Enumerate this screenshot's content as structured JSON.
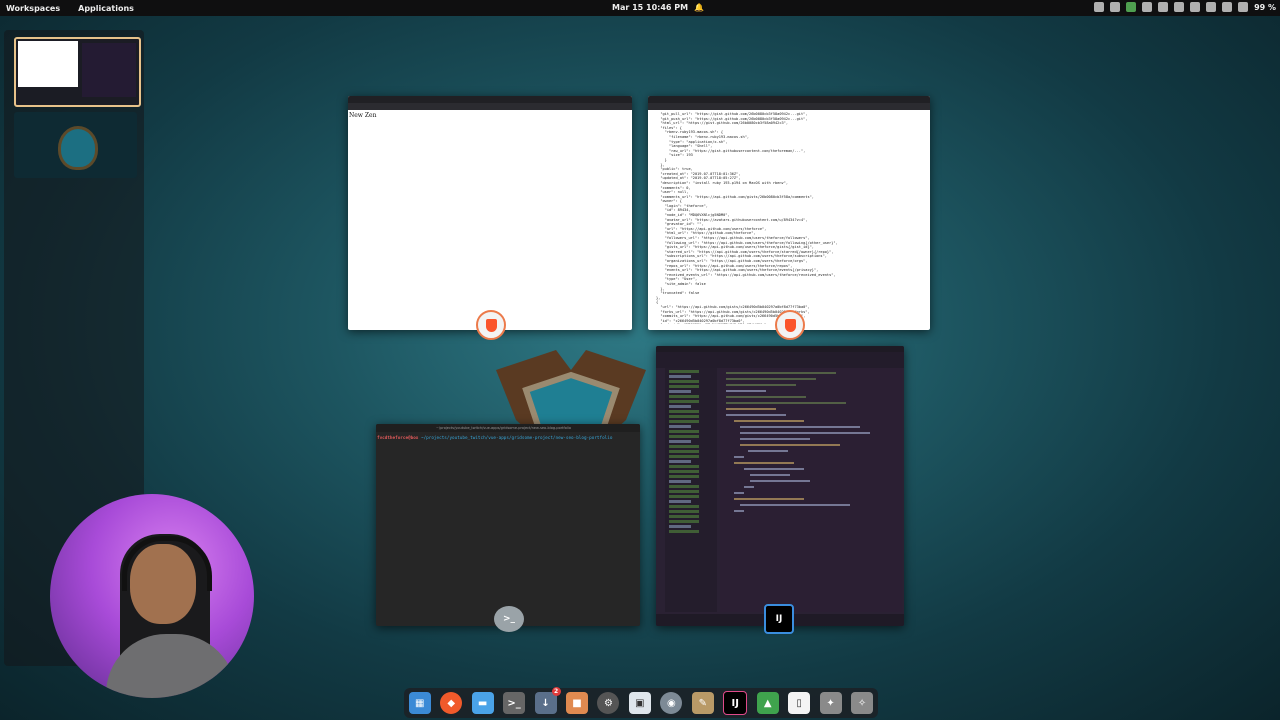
{
  "topbar": {
    "workspaces": "Workspaces",
    "applications": "Applications",
    "clock": "Mar 15  10:46 PM",
    "battery": "99 %"
  },
  "windows": {
    "browser1": {
      "page_text": "New Zen"
    },
    "browser2": {
      "json_lines": [
        "  \"git_pull_url\": \"https://gist.github.com/26b0080cb3f58a0942c...git\",",
        "  \"git_push_url\": \"https://gist.github.com/26b0080cb3f58a0942c...git\",",
        "  \"html_url\": \"https://gist.github.com/26b0080cb3f58a0942c3\",",
        "  \"files\": {",
        "    \"rbenv-ruby193-macos.sh\": {",
        "      \"filename\": \"rbenv-ruby193-macos.sh\",",
        "      \"type\": \"application/x-sh\",",
        "      \"language\": \"Shell\",",
        "      \"raw_url\": \"https://gist.githubusercontent.com/theforeman/...\",",
        "      \"size\": 193",
        "    }",
        "  },",
        "  \"public\": true,",
        "  \"created_at\": \"2019-07-07T18:01:36Z\",",
        "  \"updated_at\": \"2019-07-07T18:05:27Z\",",
        "  \"description\": \"install ruby 193-p194 on MacOS with rbenv\",",
        "  \"comments\": 0,",
        "  \"user\": null,",
        "  \"comments_url\": \"https://api.github.com/gists/26b0080cb3f58a/comments\",",
        "  \"owner\": {",
        "    \"login\": \"theforce\",",
        "    \"id\": 89434,",
        "    \"node_id\": \"MDQ6VXNlcjg5NDM0\",",
        "    \"avatar_url\": \"https://avatars.githubusercontent.com/u/89434?v=4\",",
        "    \"gravatar_id\": \"\",",
        "    \"url\": \"https://api.github.com/users/theforce\",",
        "    \"html_url\": \"https://github.com/theforce\",",
        "    \"followers_url\": \"https://api.github.com/users/theforce/followers\",",
        "    \"following_url\": \"https://api.github.com/users/theforce/following{/other_user}\",",
        "    \"gists_url\": \"https://api.github.com/users/theforce/gists{/gist_id}\",",
        "    \"starred_url\": \"https://api.github.com/users/theforce/starred{/owner}{/repo}\",",
        "    \"subscriptions_url\": \"https://api.github.com/users/theforce/subscriptions\",",
        "    \"organizations_url\": \"https://api.github.com/users/theforce/orgs\",",
        "    \"repos_url\": \"https://api.github.com/users/theforce/repos\",",
        "    \"events_url\": \"https://api.github.com/users/theforce/events{/privacy}\",",
        "    \"received_events_url\": \"https://api.github.com/users/theforce/received_events\",",
        "    \"type\": \"User\",",
        "    \"site_admin\": false",
        "  },",
        "  \"truncated\": false",
        "},",
        "{",
        "  \"url\": \"https://api.github.com/gists/c266490d5b040297a0bf8d77f73ba0\",",
        "  \"forks_url\": \"https://api.github.com/gists/c266490d5b040297a0/forks\",",
        "  \"commits_url\": \"https://api.github.com/gists/c266490d5b04/commits\",",
        "  \"id\": \"c266490d5b040297a0bf8d77f73ba0\",",
        "  \"node_id\": \"MDQ6R2lzdGMyNjY0OTBkNWIwNDAyOTdhMGJm\",",
        "  \"git_pull_url\": \"https://gist.github.com/c266490d5b04.git\","
      ]
    },
    "terminal": {
      "title": "~/projects/youtube_twitch/vue-apps/gridsome-project/new-seo-blog-portfolio",
      "prompt_user": "fvcdtheforce@box",
      "prompt_path": " ~/projects/youtube_twitch/vue-apps/gridsome-project/new-seo-blog-portfolio"
    }
  },
  "dock": {
    "icons": [
      "apps-grid-icon",
      "brave-icon",
      "files-icon",
      "terminal-icon",
      "downloads-icon",
      "store-icon",
      "settings-icon",
      "screenshot-icon",
      "obs-icon",
      "editor-icon",
      "intellij-icon",
      "android-studio-icon",
      "notepad-icon",
      "tool-icon",
      "tool-icon-2"
    ],
    "download_badge": "2"
  }
}
